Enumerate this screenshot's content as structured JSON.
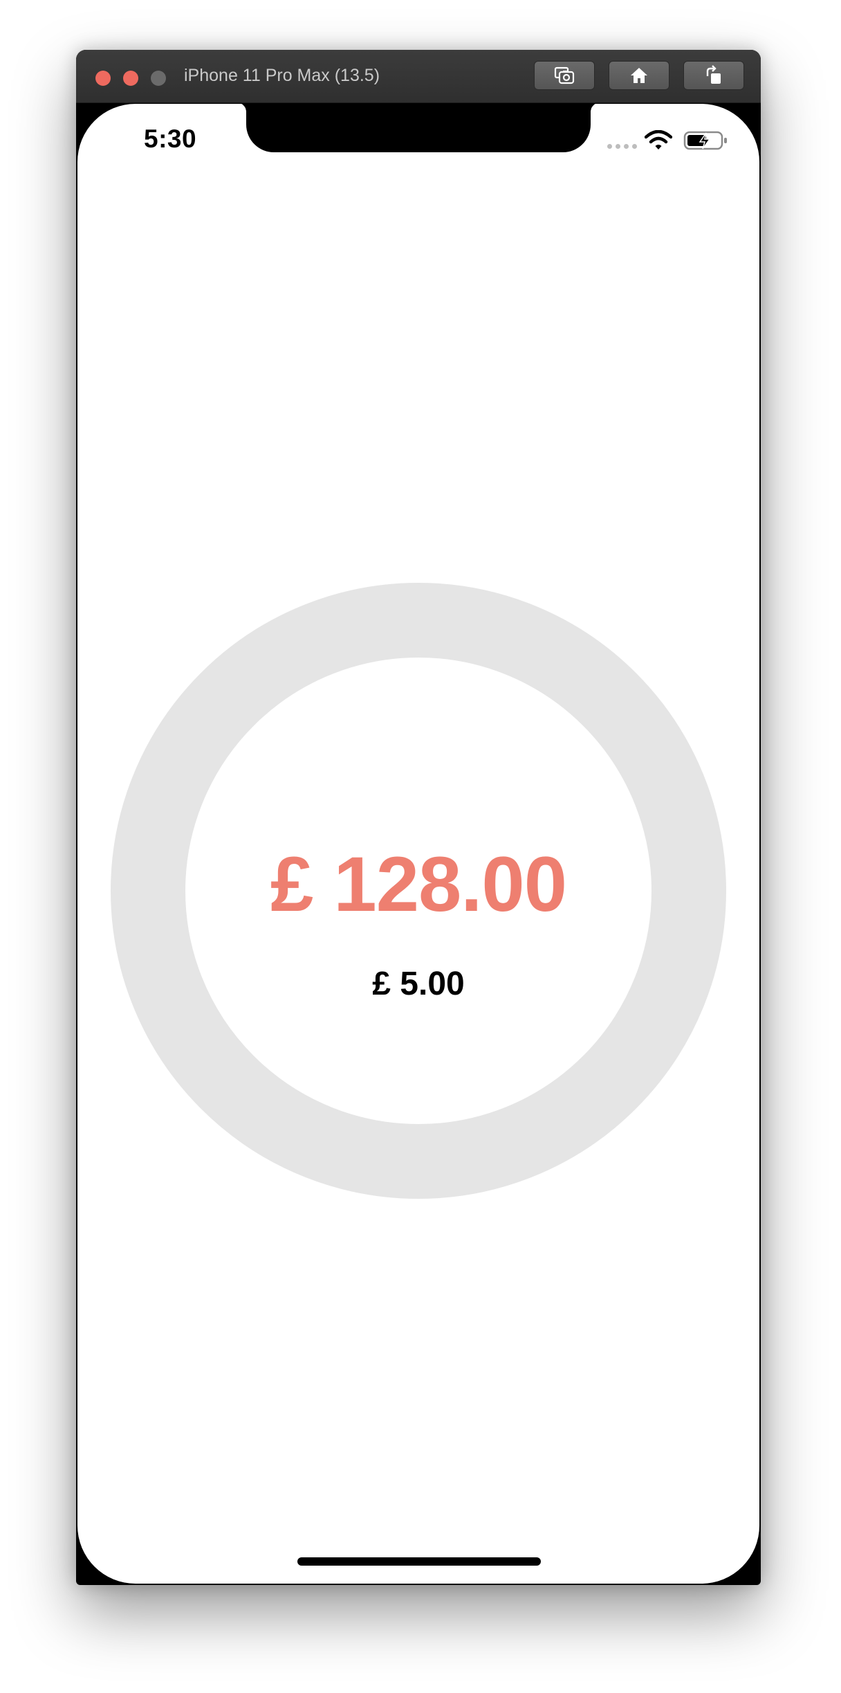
{
  "window": {
    "title": "iPhone 11 Pro Max (13.5)"
  },
  "status_bar": {
    "time": "5:30"
  },
  "meter": {
    "amount": "£ 128.00",
    "sub_amount": "£ 5.00",
    "ring_color": "#e5e5e5",
    "amount_color": "#ee7f70",
    "progress": 0
  },
  "icons": {
    "toolbar": [
      "screenshot-icon",
      "home-icon",
      "rotate-icon"
    ],
    "status": [
      "cellular-signal-icon",
      "wifi-icon",
      "battery-charging-icon"
    ]
  }
}
